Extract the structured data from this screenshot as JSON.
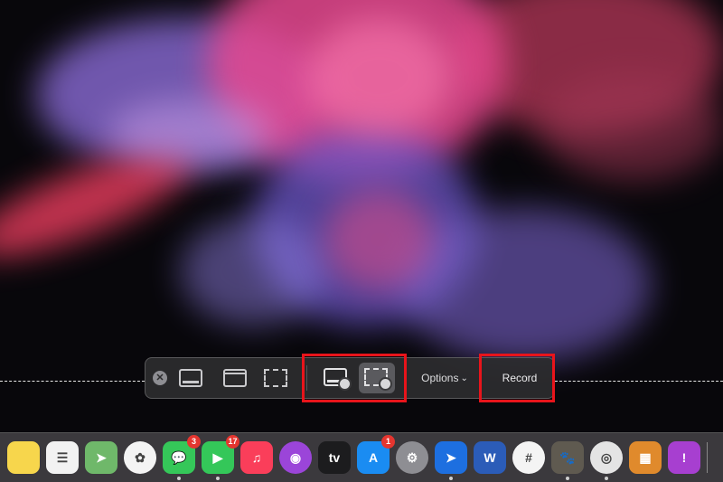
{
  "toolbar": {
    "close_icon": "close-x-icon",
    "close_glyph": "✕",
    "capture_entire_screen_icon": "capture-entire-screen-icon",
    "capture_window_icon": "capture-window-icon",
    "capture_portion_icon": "capture-selected-portion-icon",
    "record_entire_screen_icon": "record-entire-screen-icon",
    "record_portion_icon": "record-selected-portion-icon",
    "options_label": "Options",
    "options_chevron": "⌄",
    "record_label": "Record",
    "selected_mode": "record-selected-portion"
  },
  "highlight_color": "#e8141b",
  "dock": {
    "items": [
      {
        "name": "Notes",
        "icon": "notes-icon",
        "glyph": "",
        "color": "#f7d64c",
        "badge": ""
      },
      {
        "name": "Reminders",
        "icon": "reminders-icon",
        "glyph": "☰",
        "color": "#f2f2f2",
        "badge": ""
      },
      {
        "name": "Maps",
        "icon": "maps-icon",
        "glyph": "➤",
        "color": "#6fb86a",
        "badge": ""
      },
      {
        "name": "Photos",
        "icon": "photos-icon",
        "glyph": "✿",
        "color": "#f4f4f4",
        "badge": ""
      },
      {
        "name": "Messages",
        "icon": "messages-icon",
        "glyph": "💬",
        "color": "#35c759",
        "badge": "3"
      },
      {
        "name": "FaceTime",
        "icon": "facetime-icon",
        "glyph": "▶",
        "color": "#34c759",
        "badge": "17"
      },
      {
        "name": "Music",
        "icon": "music-icon",
        "glyph": "♫",
        "color": "#fa3e5a",
        "badge": ""
      },
      {
        "name": "Podcasts",
        "icon": "podcasts-icon",
        "glyph": "◉",
        "color": "#9b45d9",
        "badge": ""
      },
      {
        "name": "TV",
        "icon": "apple-tv-icon",
        "glyph": "tv",
        "color": "#1c1c1e",
        "badge": ""
      },
      {
        "name": "App Store",
        "icon": "app-store-icon",
        "glyph": "A",
        "color": "#1a8cf2",
        "badge": "1"
      },
      {
        "name": "System Preferences",
        "icon": "system-preferences-icon",
        "glyph": "⚙",
        "color": "#8e8e93",
        "badge": ""
      },
      {
        "name": "Safari Navigator",
        "icon": "navigation-arrow-icon",
        "glyph": "➤",
        "color": "#1d6fe0",
        "badge": ""
      },
      {
        "name": "Word",
        "icon": "word-icon",
        "glyph": "W",
        "color": "#2b5cb8",
        "badge": ""
      },
      {
        "name": "Slack",
        "icon": "slack-icon",
        "glyph": "#",
        "color": "#f4f4f4",
        "badge": ""
      },
      {
        "name": "GIMP",
        "icon": "gimp-icon",
        "glyph": "🐾",
        "color": "#5f5a50",
        "badge": ""
      },
      {
        "name": "Chrome",
        "icon": "chrome-icon",
        "glyph": "◎",
        "color": "#e4e4e4",
        "badge": ""
      },
      {
        "name": "Calculator",
        "icon": "calculator-icon",
        "glyph": "▦",
        "color": "#e08a2c",
        "badge": ""
      },
      {
        "name": "Feedback Assistant",
        "icon": "feedback-icon",
        "glyph": "!",
        "color": "#a73fd0",
        "badge": ""
      }
    ]
  }
}
